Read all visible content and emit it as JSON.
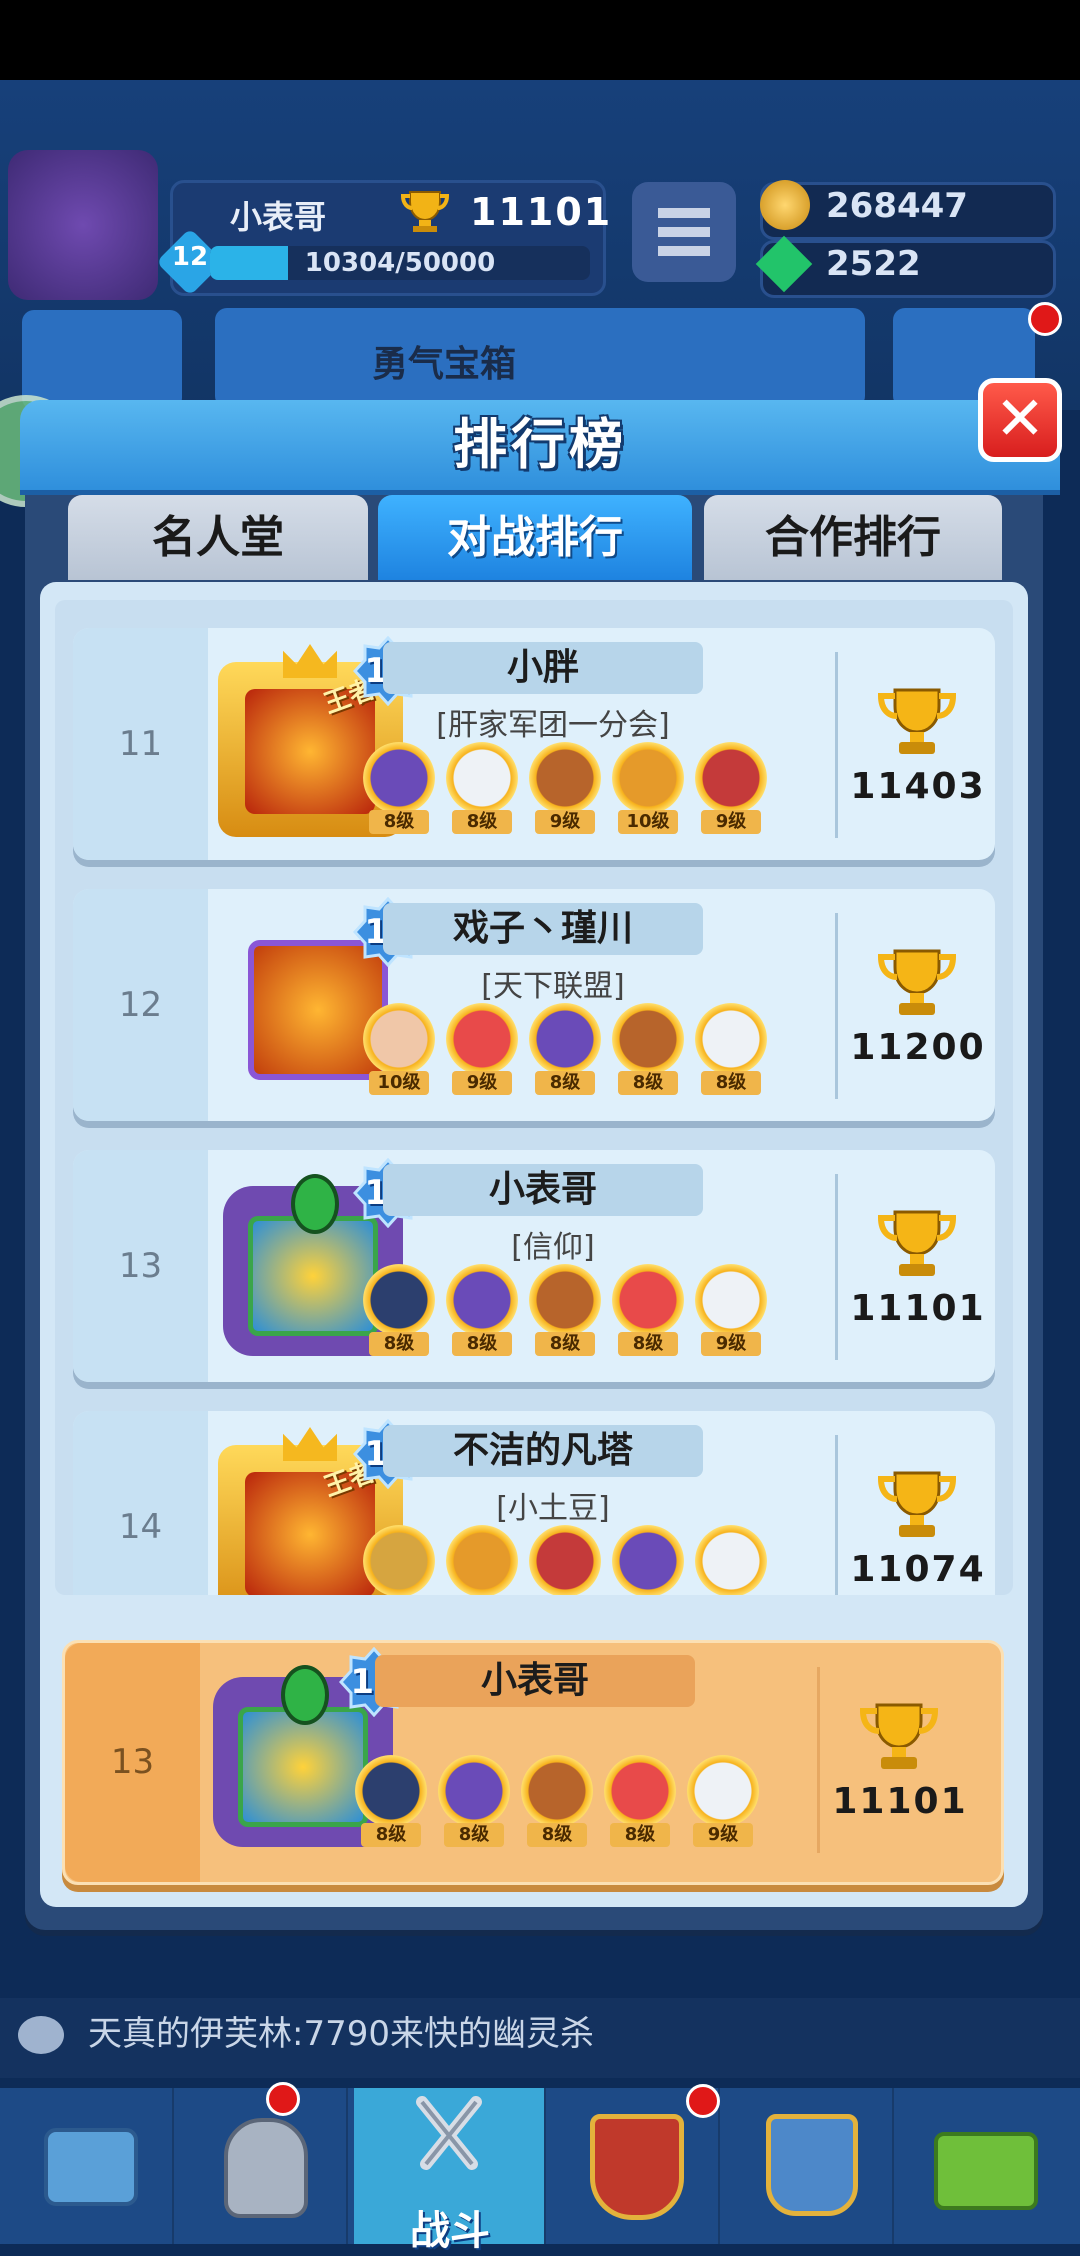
{
  "hud": {
    "player_name": "小表哥",
    "player_level": "12",
    "trophies": "11101",
    "xp": "10304/50000",
    "xp_fraction": 0.206,
    "coins": "268447",
    "gems": "2522",
    "chest_label": "勇气宝箱"
  },
  "modal": {
    "title": "排行榜",
    "tabs": [
      "名人堂",
      "对战排行",
      "合作排行"
    ],
    "active_tab": 1
  },
  "rows": [
    {
      "rank": "11",
      "level": "12",
      "name": "小胖",
      "guild": "[肝家军团一分会]",
      "trophies": "11403",
      "avatar": "king-frame-avatar",
      "heroes": [
        {
          "icon": "purple-ninja-hero",
          "lvl": "8级"
        },
        {
          "icon": "white-ghost-hero",
          "lvl": "8级"
        },
        {
          "icon": "bearded-chef-hero",
          "lvl": "9级"
        },
        {
          "icon": "monkey-king-hero",
          "lvl": "10级"
        },
        {
          "icon": "red-bird-hero",
          "lvl": "9级"
        }
      ]
    },
    {
      "rank": "12",
      "level": "11",
      "name": "戏子丶瑾川",
      "guild": "[天下联盟]",
      "trophies": "11200",
      "avatar": "purple-frame-avatar",
      "heroes": [
        {
          "icon": "girl-hero",
          "lvl": "10级"
        },
        {
          "icon": "clown-hero",
          "lvl": "9级"
        },
        {
          "icon": "purple-ninja-hero",
          "lvl": "8级"
        },
        {
          "icon": "bearded-chef-hero",
          "lvl": "8级"
        },
        {
          "icon": "white-ghost-hero",
          "lvl": "8级"
        }
      ]
    },
    {
      "rank": "13",
      "level": "12",
      "name": "小表哥",
      "guild": "[信仰]",
      "trophies": "11101",
      "avatar": "eye-frame-avatar",
      "heroes": [
        {
          "icon": "police-hero",
          "lvl": "8级"
        },
        {
          "icon": "purple-ninja-hero",
          "lvl": "8级"
        },
        {
          "icon": "bearded-chef-hero",
          "lvl": "8级"
        },
        {
          "icon": "clown-hero",
          "lvl": "8级"
        },
        {
          "icon": "white-ghost-hero",
          "lvl": "9级"
        }
      ]
    },
    {
      "rank": "14",
      "level": "13",
      "name": "不洁的凡塔",
      "guild": "[小土豆]",
      "trophies": "11074",
      "avatar": "king-frame-avatar",
      "heroes": [
        {
          "icon": "straw-hat-hero",
          "lvl": ""
        },
        {
          "icon": "monkey-king-hero",
          "lvl": ""
        },
        {
          "icon": "red-bird-hero",
          "lvl": ""
        },
        {
          "icon": "purple-ninja-hero",
          "lvl": ""
        },
        {
          "icon": "white-ghost-hero",
          "lvl": ""
        }
      ]
    }
  ],
  "king_label": "王者",
  "self_row": {
    "rank": "13",
    "level": "12",
    "name": "小表哥",
    "trophies": "11101",
    "heroes": [
      {
        "icon": "police-hero",
        "lvl": "8级"
      },
      {
        "icon": "purple-ninja-hero",
        "lvl": "8级"
      },
      {
        "icon": "bearded-chef-hero",
        "lvl": "8级"
      },
      {
        "icon": "clown-hero",
        "lvl": "8级"
      },
      {
        "icon": "white-ghost-hero",
        "lvl": "9级"
      }
    ]
  },
  "chat": {
    "message": "天真的伊芙林:7790来快的幽灵杀"
  },
  "nav": {
    "battle_label": "战斗"
  },
  "colors": {
    "accent_blue": "#2f8fdc",
    "self_row": "#f6c07c",
    "close_red": "#d81e1e"
  }
}
